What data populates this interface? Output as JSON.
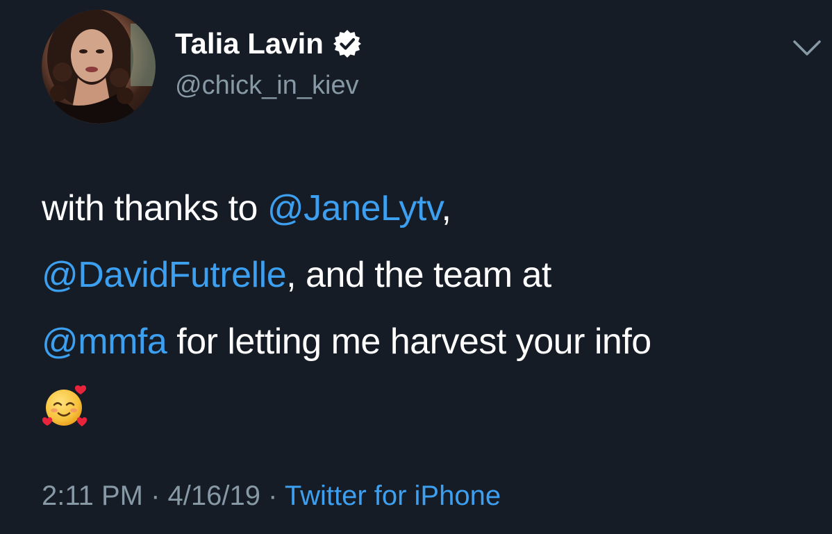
{
  "author": {
    "display_name": "Talia Lavin",
    "handle": "@chick_in_kiev",
    "verified": true,
    "avatar_icon": "profile-photo"
  },
  "tweet": {
    "text_1": "with thanks to ",
    "mention_1": "@JaneLytv",
    "text_2": ",",
    "mention_2": "@DavidFutrelle",
    "text_3": ", and the team at",
    "mention_3": "@mmfa",
    "text_4": " for letting me harvest your info",
    "emoji": "smiling-face-with-hearts"
  },
  "meta": {
    "time": "2:11 PM",
    "sep_1": " · ",
    "date": "4/16/19",
    "sep_2": " · ",
    "source": "Twitter for iPhone"
  },
  "colors": {
    "background": "#151c26",
    "link": "#3d9ff0",
    "secondary_text": "#8899a6",
    "primary_text": "#ffffff"
  },
  "icons": {
    "menu": "chevron-down-icon",
    "verified": "verified-badge-icon"
  }
}
